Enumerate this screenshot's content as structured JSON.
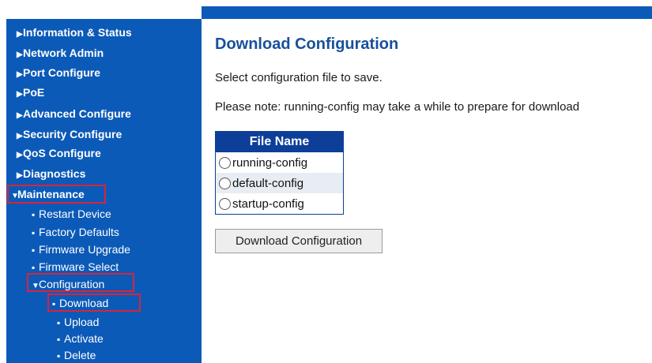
{
  "sidebar": {
    "top_items": [
      "Information & Status",
      "Network Admin",
      "Port Configure",
      "PoE",
      "Advanced Configure",
      "Security Configure",
      "QoS Configure",
      "Diagnostics",
      "Maintenance"
    ],
    "maintenance_items": [
      "Restart Device",
      "Factory Defaults",
      "Firmware Upgrade",
      "Firmware Select",
      "Configuration"
    ],
    "configuration_items": [
      "Download",
      "Upload",
      "Activate",
      "Delete"
    ]
  },
  "main": {
    "title": "Download Configuration",
    "instruction": "Select configuration file to save.",
    "note": "Please note: running-config may take a while to prepare for download",
    "table_header": "File Name",
    "files": [
      "running-config",
      "default-config",
      "startup-config"
    ],
    "button_label": "Download Configuration"
  },
  "colors": {
    "nav_background": "#0c5ab8",
    "title": "#17509c",
    "table_header": "#0d3f99",
    "highlight_border": "#d8243a"
  }
}
